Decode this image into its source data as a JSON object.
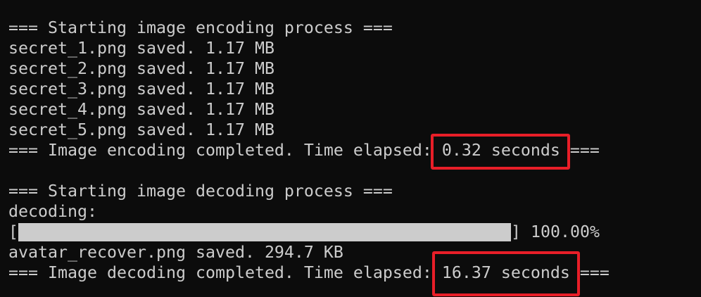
{
  "lines": {
    "enc_start": "=== Starting image encoding process ===",
    "saved": [
      "secret_1.png saved. 1.17 MB",
      "secret_2.png saved. 1.17 MB",
      "secret_3.png saved. 1.17 MB",
      "secret_4.png saved. 1.17 MB",
      "secret_5.png saved. 1.17 MB"
    ],
    "enc_done_prefix": "=== Image encoding completed. Time elapsed: ",
    "enc_time": "0.32 seconds",
    "enc_done_suffix": " ===",
    "dec_start": "=== Starting image decoding process ===",
    "decoding_label": "decoding:",
    "bracket_open": "[",
    "bracket_close": "] ",
    "progress_text": "100.00%",
    "dec_saved": "avatar_recover.png saved. 294.7 KB",
    "dec_done_prefix": "=== Image decoding completed. Time elapsed: ",
    "dec_time": "16.37 seconds",
    "dec_done_suffix": " ==="
  },
  "progress_fraction": 1.0,
  "colors": {
    "background": "#0c0c0c",
    "text": "#cccccc",
    "highlight_box": "#e81e28"
  }
}
